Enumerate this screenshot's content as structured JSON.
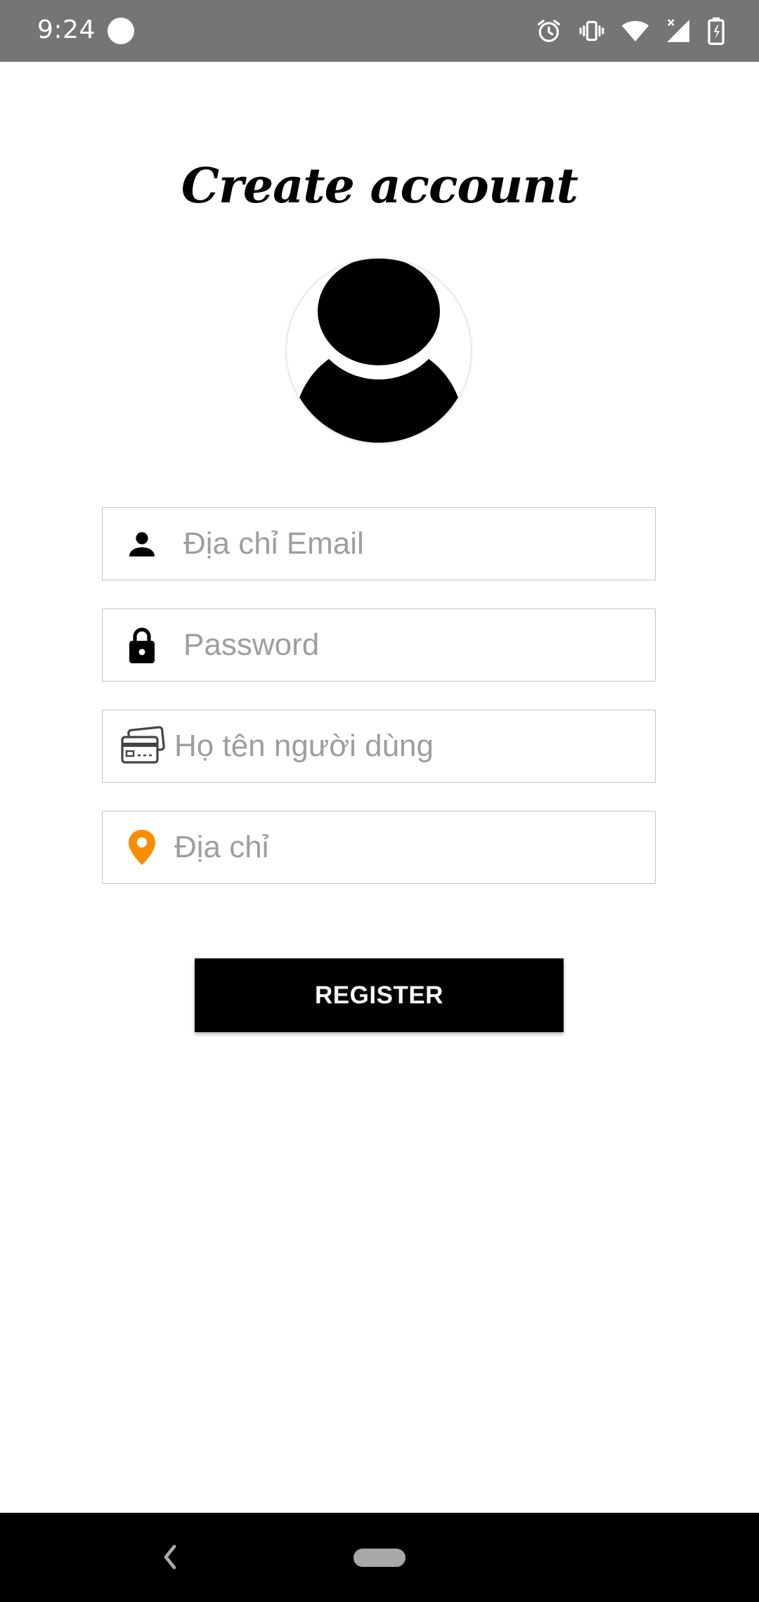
{
  "status_bar": {
    "time": "9:24",
    "icons": [
      "notification-dot-icon",
      "alarm-icon",
      "vibrate-icon",
      "wifi-icon",
      "signal-icon",
      "battery-charging-icon"
    ]
  },
  "page": {
    "title": "Create account",
    "avatar": "default-avatar-icon"
  },
  "form": {
    "email": {
      "placeholder": "Địa chỉ Email",
      "value": "",
      "icon": "person-icon"
    },
    "password": {
      "placeholder": "Password",
      "value": "",
      "icon": "lock-icon"
    },
    "fullname": {
      "placeholder": "Họ tên người dùng",
      "value": "",
      "icon": "card-icon"
    },
    "address": {
      "placeholder": "Địa chỉ",
      "value": "",
      "icon": "location-pin-icon"
    },
    "register_label": "REGISTER"
  },
  "colors": {
    "status_bar": "#757575",
    "button": "#000000",
    "pin": "#FB8C00",
    "placeholder": "#9E9E9E",
    "border": "#C4C4C4"
  },
  "nav_bar": {
    "icons": [
      "back-icon",
      "home-pill-icon"
    ]
  }
}
